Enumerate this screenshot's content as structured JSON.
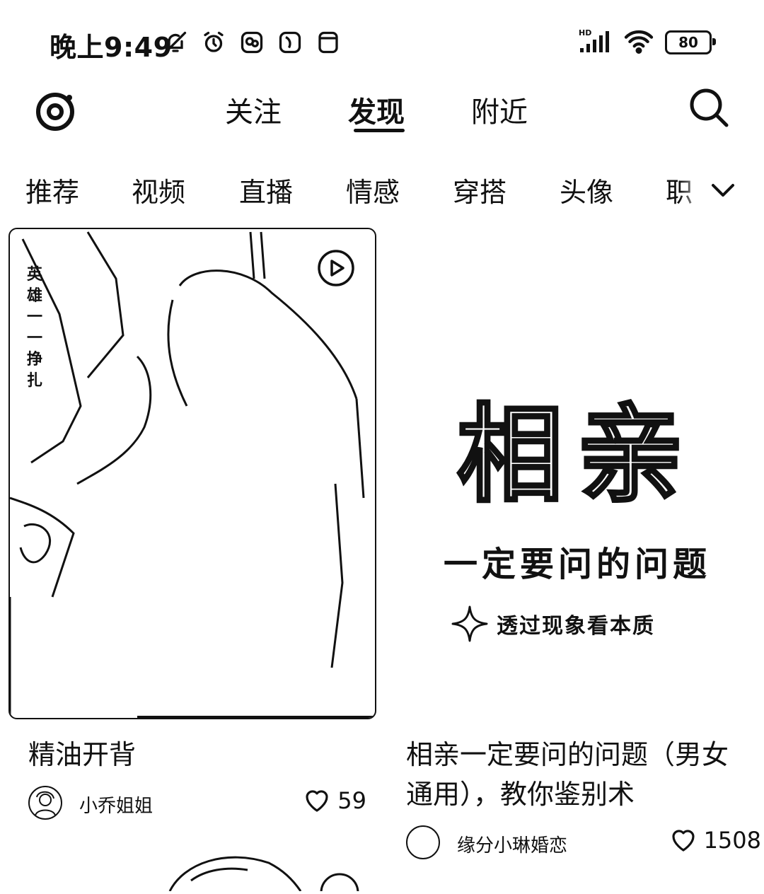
{
  "status_bar": {
    "time": "晚上9:49",
    "left_icons": [
      "bell-off-icon",
      "alarm-icon",
      "app-notification-icon",
      "app-notification-icon-2",
      "window-icon"
    ],
    "battery": "80"
  },
  "top_nav": {
    "tabs": [
      {
        "label": "关注",
        "active": false
      },
      {
        "label": "发现",
        "active": true
      },
      {
        "label": "附近",
        "active": false
      }
    ]
  },
  "categories": {
    "items": [
      "推荐",
      "视频",
      "直播",
      "情感",
      "穿搭",
      "头像",
      "职"
    ]
  },
  "feed": [
    {
      "title": "精油开背",
      "image_caption": "英雄一一挣扎",
      "author": "小乔姐姐",
      "likes": "59",
      "is_video": true
    },
    {
      "title": "相亲一定要问的问题（男女通用），教你鉴别术",
      "poster": {
        "headline": "相亲",
        "subtitle": "一定要问的问题",
        "tagline": "透过现象看本质"
      },
      "author": "缘分小琳婚恋",
      "likes": "1508",
      "is_video": false
    }
  ]
}
